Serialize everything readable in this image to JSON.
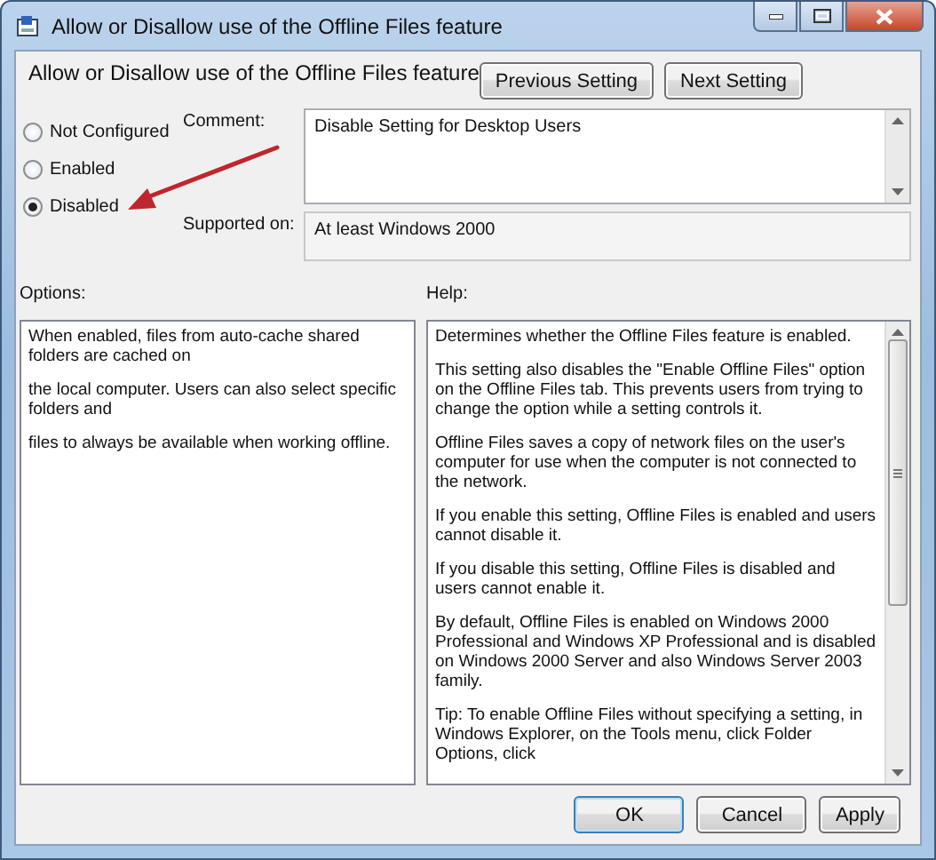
{
  "window": {
    "title": "Allow or Disallow use of the Offline Files feature"
  },
  "header": {
    "title": "Allow or Disallow use of the Offline Files feature"
  },
  "nav_buttons": [
    "Previous Setting",
    "Next Setting"
  ],
  "states": [
    {
      "label": "Not Configured",
      "selected": false
    },
    {
      "label": "Enabled",
      "selected": false
    },
    {
      "label": "Disabled",
      "selected": true
    }
  ],
  "comment": {
    "label": "Comment:",
    "value": "Disable Setting for Desktop Users"
  },
  "supported_on": {
    "label": "Supported on:",
    "value": "At least Windows 2000"
  },
  "options": {
    "label": "Options:",
    "paragraphs": [
      "When enabled, files from auto-cache shared folders are cached on",
      "the local computer. Users can also select specific folders and",
      "files to always be available when working offline."
    ]
  },
  "help": {
    "label": "Help:",
    "paragraphs": [
      "Determines whether the Offline Files feature is enabled.",
      "This setting also disables the \"Enable Offline Files\" option on the Offline Files tab. This prevents users from trying to change the option while a setting controls it.",
      "Offline Files saves a copy of network files on the user's computer for use when the computer is not connected to the network.",
      "If you enable this setting, Offline Files is enabled and users cannot disable it.",
      "If you disable this setting, Offline Files is disabled and users cannot enable it.",
      "By default, Offline Files is enabled on Windows 2000 Professional and Windows XP Professional and is disabled on Windows 2000 Server and also Windows Server 2003 family.",
      "Tip: To enable Offline Files without specifying a setting, in Windows Explorer, on the Tools menu, click Folder Options, click"
    ]
  },
  "buttons": [
    "OK",
    "Cancel",
    "Apply"
  ]
}
